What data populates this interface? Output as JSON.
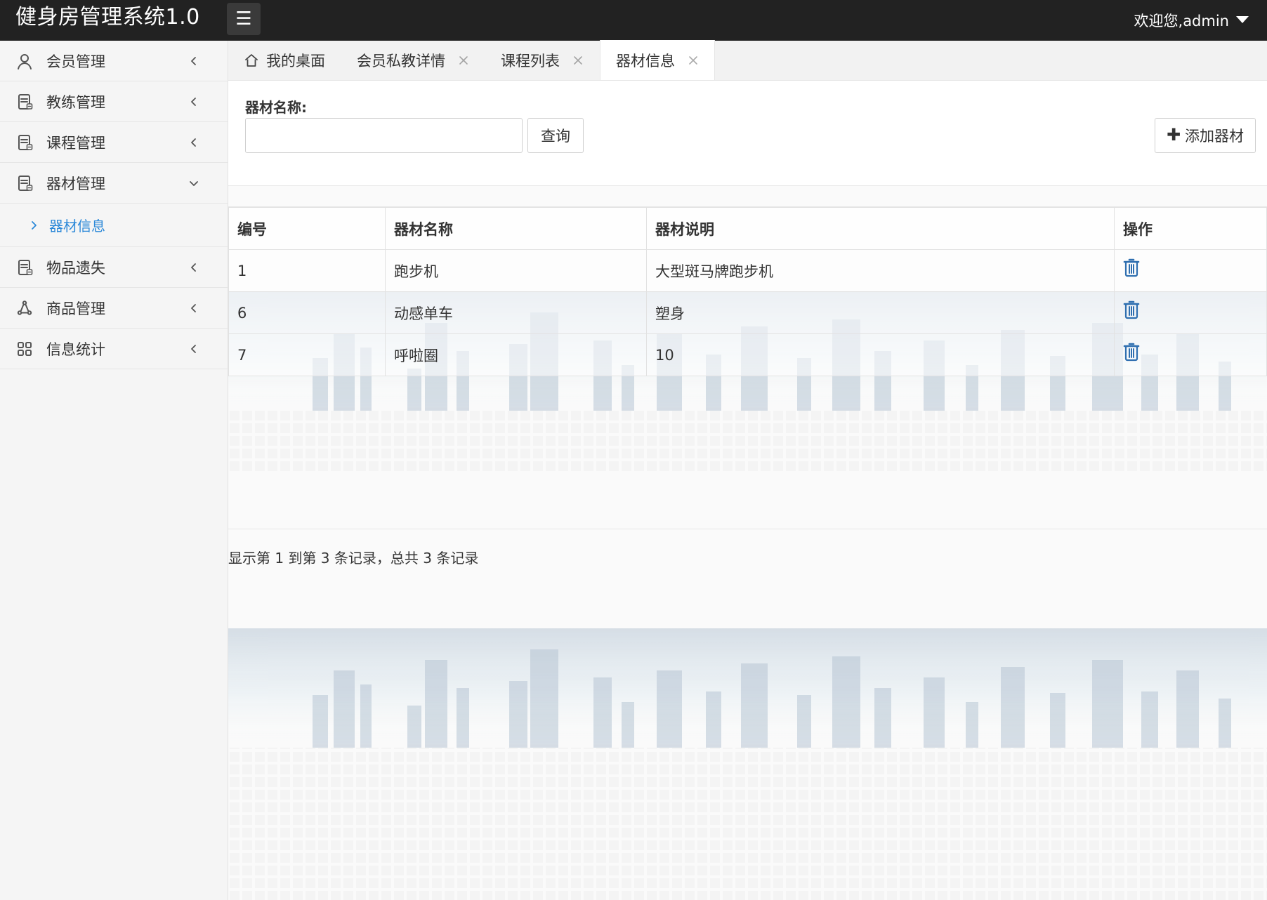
{
  "topbar": {
    "title": "健身房管理系统1.0",
    "user_label": "欢迎您,admin"
  },
  "sidebar": {
    "items": [
      {
        "label": "会员管理",
        "icon": "user-icon"
      },
      {
        "label": "教练管理",
        "icon": "document-icon"
      },
      {
        "label": "课程管理",
        "icon": "document-icon"
      },
      {
        "label": "器材管理",
        "icon": "document-icon",
        "expanded": true,
        "children": [
          {
            "label": "器材信息"
          }
        ]
      },
      {
        "label": "物品遗失",
        "icon": "document-icon"
      },
      {
        "label": "商品管理",
        "icon": "network-icon"
      },
      {
        "label": "信息统计",
        "icon": "grid-icon"
      }
    ]
  },
  "tabs": [
    {
      "label": "我的桌面",
      "icon": "home-icon",
      "closable": false,
      "active": false
    },
    {
      "label": "会员私教详情",
      "closable": true,
      "active": false
    },
    {
      "label": "课程列表",
      "closable": true,
      "active": false
    },
    {
      "label": "器材信息",
      "closable": true,
      "active": true
    }
  ],
  "search": {
    "label": "器材名称:",
    "value": "",
    "placeholder": "",
    "search_button": "查询",
    "add_button": "添加器材"
  },
  "table": {
    "headers": [
      "编号",
      "器材名称",
      "器材说明",
      "操作"
    ],
    "rows": [
      {
        "id": "1",
        "name": "跑步机",
        "desc": "大型斑马牌跑步机"
      },
      {
        "id": "6",
        "name": "动感单车",
        "desc": "塑身"
      },
      {
        "id": "7",
        "name": "呼啦圈",
        "desc": "10"
      }
    ]
  },
  "pagination": {
    "summary": "显示第 1 到第 3 条记录，总共 3 条记录"
  },
  "colors": {
    "topbar_bg": "#222222",
    "sidebar_active": "#2b88d8",
    "trash_icon": "#2f6fb0"
  }
}
